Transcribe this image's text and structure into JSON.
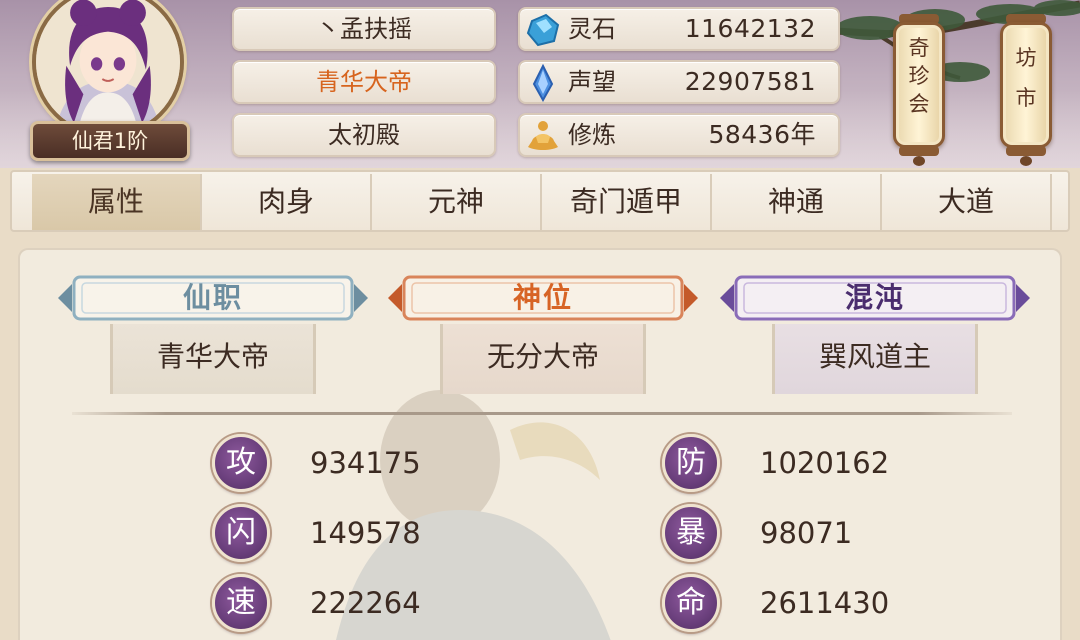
{
  "player": {
    "name": "丶孟扶摇",
    "title": "青华大帝",
    "hall": "太初殿",
    "rank": "仙君1阶"
  },
  "resources": [
    {
      "label": "灵石",
      "value": "11642132",
      "icon": "spirit-stone-icon"
    },
    {
      "label": "声望",
      "value": "22907581",
      "icon": "prestige-crystal-icon"
    },
    {
      "label": "修炼",
      "value": "58436年",
      "icon": "meditation-icon"
    }
  ],
  "shortcuts": {
    "treasure_fair": "奇珍会",
    "market": "坊市"
  },
  "tabs": [
    "属性",
    "肉身",
    "元神",
    "奇门遁甲",
    "神通",
    "大道"
  ],
  "active_tab": "属性",
  "ranks": [
    {
      "heading": "仙职",
      "value": "青华大帝",
      "color": "#6d8ea0"
    },
    {
      "heading": "神位",
      "value": "无分大帝",
      "color": "#d76425"
    },
    {
      "heading": "混沌",
      "value": "巽风道主",
      "color": "#4a2d6e"
    }
  ],
  "stats": [
    {
      "key": "攻",
      "value": "934175"
    },
    {
      "key": "防",
      "value": "1020162"
    },
    {
      "key": "闪",
      "value": "149578"
    },
    {
      "key": "暴",
      "value": "98071"
    },
    {
      "key": "速",
      "value": "222264"
    },
    {
      "key": "命",
      "value": "2611430"
    }
  ]
}
